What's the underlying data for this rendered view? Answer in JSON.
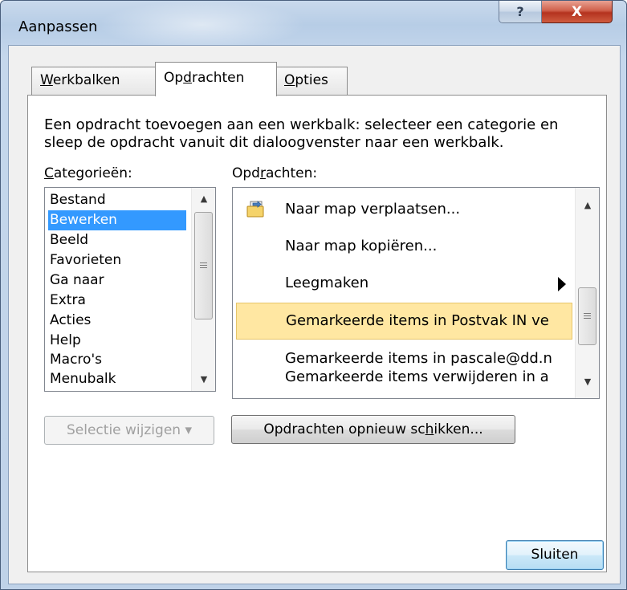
{
  "window": {
    "title": "Aanpassen",
    "help_glyph": "?",
    "close_glyph": "X"
  },
  "tabs": [
    {
      "before": "",
      "access": "W",
      "after": "erkbalken"
    },
    {
      "before": "Op",
      "access": "d",
      "after": "rachten"
    },
    {
      "before": "",
      "access": "O",
      "after": "pties"
    }
  ],
  "active_tab": "Opdrachten",
  "description": "Een opdracht toevoegen aan een werkbalk: selecteer een categorie en sleep de opdracht vanuit dit dialoogvenster naar een werkbalk.",
  "categories": {
    "label_access": "C",
    "label_rest": "ategorieën:",
    "items": [
      "Bestand",
      "Bewerken",
      "Beeld",
      "Favorieten",
      "Ga naar",
      "Extra",
      "Acties",
      "Help",
      "Macro's",
      "Menubalk"
    ],
    "selected": "Bewerken"
  },
  "commands": {
    "label_before": "Opd",
    "label_access": "r",
    "label_after": "achten:",
    "items": [
      {
        "label": "Naar map verplaatsen...",
        "icon": "move-to-folder-icon"
      },
      {
        "label": "Naar map kopiëren..."
      },
      {
        "label": "Leegmaken",
        "submenu": true
      },
      {
        "label": "Gemarkeerde items in Postvak IN ve",
        "selected": true
      },
      {
        "label": "Gemarkeerde items in pascale@dd.n"
      },
      {
        "label": "Gemarkeerde items verwijderen in a"
      }
    ]
  },
  "buttons": {
    "modify_selection": "Selectie wijzigen ▾",
    "rearrange_before": "Opdrachten opnieuw sc",
    "rearrange_access": "h",
    "rearrange_after": "ikken...",
    "close": "Sluiten"
  },
  "colors": {
    "selection_blue": "#3399ff",
    "highlight_yellow": "#ffe7a2",
    "close_red": "#c8432c"
  }
}
